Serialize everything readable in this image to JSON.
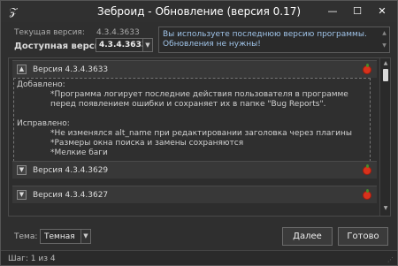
{
  "window": {
    "title": "Зеброид - Обновление (версия 0.17)",
    "minimize": "—",
    "maximize": "☐",
    "close": "✕"
  },
  "header": {
    "current_label": "Текущая версия:",
    "current_value": "4.3.4.3633",
    "available_label": "Доступная версия:",
    "available_value": "4.3.4.3633",
    "status_message": "Вы используете последнюю версию программы. Обновления не нужны!"
  },
  "changelog": {
    "sections": [
      {
        "title": "Версия 4.3.4.3633",
        "expanded": true,
        "added_heading": "Добавлено:",
        "added_items": [
          "Программа логирует последние действия пользователя в программе перед появлением ошибки и сохраняет их в папке \"Bug Reports\"."
        ],
        "fixed_heading": "Исправлено:",
        "fixed_items": [
          "Не изменялся alt_name при редактировании заголовка через плагины",
          "Размеры окна поиска и замены сохраняются",
          "Мелкие баги"
        ]
      },
      {
        "title": "Версия 4.3.4.3629",
        "expanded": false
      },
      {
        "title": "Версия 4.3.4.3627",
        "expanded": false
      }
    ]
  },
  "footer": {
    "theme_label": "Тема:",
    "theme_value": "Темная",
    "next_button": "Далее",
    "done_button": "Готово",
    "step_text": "Шаг: 1 из 4"
  },
  "colors": {
    "background": "#2f2f2f",
    "status_text": "#9fc3e8",
    "icon_red": "#d8321c"
  }
}
